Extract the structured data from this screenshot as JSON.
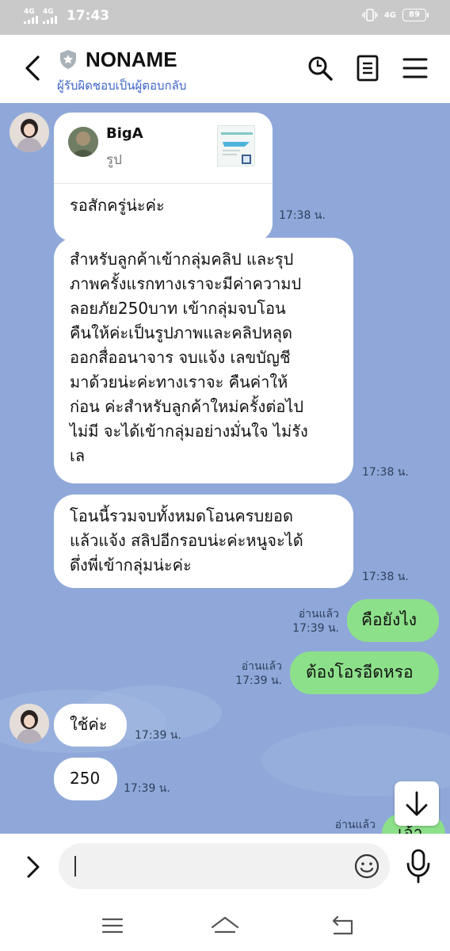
{
  "status_bar": {
    "network_left_1": "4G",
    "network_left_2": "4G",
    "time": "17:43",
    "network_right": "4G",
    "battery": "89"
  },
  "header": {
    "title": "NONAME",
    "subtitle": "ผู้รับผิดชอบเป็นผู้ตอบกลับ"
  },
  "messages": {
    "quote": {
      "name": "BigA",
      "type": "รูป"
    },
    "m1": {
      "text": "รอสักครู่น่ะค่ะ",
      "time": "17:38 น."
    },
    "m2": {
      "lines": [
        "สำหรับลูกค้าเข้ากลุ่มคลิป และรุป",
        "ภาพครั้งแรกทางเราจะมีค่าความป",
        "ลอยภัย250บาท เข้ากลุ่มจบโอน",
        "คืนให้ค่ะเป็นรูปภาพและคลิปหลุด",
        "ออกสื่ออนาจาร จบแจ้ง เลขบัญชี",
        "มาด้วยน่ะค่ะทางเราจะ คืนค่าให้",
        "ก่อน ค่ะสำหรับลูกค้าใหม่ครั้งต่อไป",
        "ไม่มี จะได้เข้ากลุ่มอย่างมั่นใจ ไม่รัง",
        "เล"
      ],
      "time": "17:38 น."
    },
    "m3": {
      "lines": [
        "โอนนี้รวมจบทั้งหมดโอนครบยอด",
        "แล้วแจ้ง สลิปอีกรอบน่ะค่ะหนูจะได้",
        "ดึ่งพี่เข้ากลุ่มน่ะค่ะ"
      ],
      "time": "17:38 น."
    },
    "m4": {
      "text": "คือยังไง",
      "read": "อ่านแล้ว",
      "time": "17:39 น."
    },
    "m5": {
      "text": "ต้องโอรอีดหรอ",
      "read": "อ่านแล้ว",
      "time": "17:39 น."
    },
    "m6": {
      "text": "ใช้ค่ะ",
      "time": "17:39 น."
    },
    "m7": {
      "text": "250",
      "time": "17:39 น."
    },
    "m8": {
      "text": "เอ้า",
      "read": "อ่านแล้ว"
    }
  },
  "colors": {
    "chat_bg": "#8fa8d9",
    "outgoing_bubble": "#8de08a",
    "incoming_bubble": "#ffffff",
    "subtitle": "#3c64c6"
  }
}
